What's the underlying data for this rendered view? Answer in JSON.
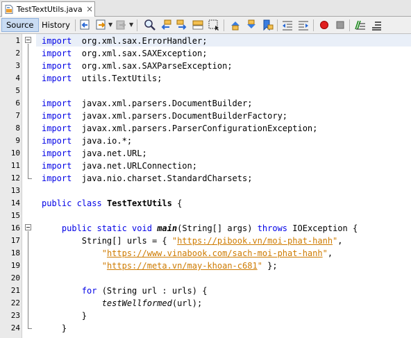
{
  "file_tab": {
    "title": "TestTextUtils.java",
    "close_glyph": "×",
    "icon": "java-file-icon"
  },
  "toolbar": {
    "source_label": "Source",
    "history_label": "History",
    "icons": [
      "last-edit-icon",
      "back-icon",
      "forward-icon",
      "find-selection-icon",
      "find-previous-icon",
      "find-next-icon",
      "toggle-highlight-icon",
      "toggle-rect-selection-icon",
      "previous-bookmark-icon",
      "next-bookmark-icon",
      "toggle-bookmark-icon",
      "shift-left-icon",
      "shift-right-icon",
      "start-macro-icon",
      "stop-macro-icon",
      "toggle-comment-icon",
      "uncomment-icon"
    ]
  },
  "editor": {
    "line_numbers": [
      "1",
      "2",
      "3",
      "4",
      "5",
      "6",
      "7",
      "8",
      "9",
      "10",
      "11",
      "12",
      "13",
      "14",
      "15",
      "16",
      "17",
      "18",
      "19",
      "20",
      "21",
      "22",
      "23",
      "24"
    ],
    "lines": [
      [
        [
          "kw",
          "import"
        ],
        [
          "",
          "  org.xml.sax.ErrorHandler;"
        ]
      ],
      [
        [
          "kw",
          "import"
        ],
        [
          "",
          "  org.xml.sax.SAXException;"
        ]
      ],
      [
        [
          "kw",
          "import"
        ],
        [
          "",
          "  org.xml.sax.SAXParseException;"
        ]
      ],
      [
        [
          "kw",
          "import"
        ],
        [
          "",
          "  utils.TextUtils;"
        ]
      ],
      [],
      [
        [
          "kw",
          "import"
        ],
        [
          "",
          "  javax.xml.parsers.DocumentBuilder;"
        ]
      ],
      [
        [
          "kw",
          "import"
        ],
        [
          "",
          "  javax.xml.parsers.DocumentBuilderFactory;"
        ]
      ],
      [
        [
          "kw",
          "import"
        ],
        [
          "",
          "  javax.xml.parsers.ParserConfigurationException;"
        ]
      ],
      [
        [
          "kw",
          "import"
        ],
        [
          "",
          "  java.io.*;"
        ]
      ],
      [
        [
          "kw",
          "import"
        ],
        [
          "",
          "  java.net.URL;"
        ]
      ],
      [
        [
          "kw",
          "import"
        ],
        [
          "",
          "  java.net.URLConnection;"
        ]
      ],
      [
        [
          "kw",
          "import"
        ],
        [
          "",
          "  java.nio.charset.StandardCharsets;"
        ]
      ],
      [],
      [
        [
          "kw",
          "public class"
        ],
        [
          "",
          " "
        ],
        [
          "cls",
          "TestTextUtils"
        ],
        [
          "",
          " {"
        ]
      ],
      [],
      [
        [
          "",
          "    "
        ],
        [
          "kw",
          "public static void"
        ],
        [
          "",
          " "
        ],
        [
          "m",
          "main"
        ],
        [
          "",
          "(String[] args) "
        ],
        [
          "kw",
          "throws"
        ],
        [
          "",
          " IOException {"
        ]
      ],
      [
        [
          "",
          "        String[] urls = { "
        ],
        [
          "str",
          "\""
        ],
        [
          "str url",
          "https://pibook.vn/moi-phat-hanh"
        ],
        [
          "str",
          "\""
        ],
        [
          "",
          ","
        ]
      ],
      [
        [
          "",
          "            "
        ],
        [
          "str",
          "\""
        ],
        [
          "str url",
          "https://www.vinabook.com/sach-moi-phat-hanh"
        ],
        [
          "str",
          "\""
        ],
        [
          "",
          ","
        ]
      ],
      [
        [
          "",
          "            "
        ],
        [
          "str",
          "\""
        ],
        [
          "str url",
          "https://meta.vn/may-khoan-c681"
        ],
        [
          "str",
          "\""
        ],
        [
          "",
          " };"
        ]
      ],
      [],
      [
        [
          "",
          "        "
        ],
        [
          "kw",
          "for"
        ],
        [
          "",
          " (String url : urls) {"
        ]
      ],
      [
        [
          "",
          "            "
        ],
        [
          "it",
          "testWellformed"
        ],
        [
          "",
          "(url);"
        ]
      ],
      [
        [
          "",
          "        }"
        ]
      ],
      [
        [
          "",
          "    }"
        ]
      ]
    ]
  }
}
